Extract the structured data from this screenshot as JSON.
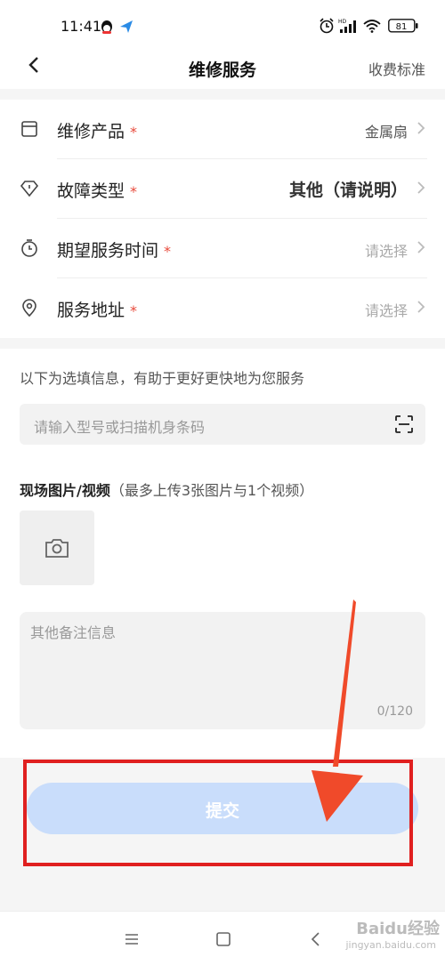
{
  "status_bar": {
    "time": "11:41",
    "battery": "81"
  },
  "header": {
    "back_icon": "chevron-left-icon",
    "title": "维修服务",
    "fee_link": "收费标准"
  },
  "form_rows": [
    {
      "label": "维修产品",
      "required_mark": "*",
      "value": "金属扇",
      "icon": "product-box-icon"
    },
    {
      "label": "故障类型",
      "required_mark": "*",
      "value": "其他（请说明）",
      "icon": "diamond-fault-icon"
    },
    {
      "label": "期望服务时间",
      "required_mark": "*",
      "value": "请选择",
      "icon": "stopwatch-icon"
    },
    {
      "label": "服务地址",
      "required_mark": "*",
      "value": "请选择",
      "icon": "location-pin-icon"
    }
  ],
  "optional_hint": "以下为选填信息，有助于更好更快地为您服务",
  "model_input": {
    "placeholder": "请输入型号或扫描机身条码",
    "scan_icon": "scan-icon"
  },
  "media": {
    "title": "现场图片/视频",
    "subtitle": "（最多上传3张图片与1个视频）",
    "upload_icon": "camera-icon"
  },
  "remarks": {
    "placeholder": "其他备注信息",
    "counter": "0/120"
  },
  "submit": {
    "label": "提交"
  },
  "watermark": {
    "text": "Baidu经验",
    "sub": "jingyan.baidu.com"
  },
  "colors": {
    "required": "#e84a3b",
    "submit_bg": "#c9ddfb",
    "highlight": "#e02020"
  }
}
